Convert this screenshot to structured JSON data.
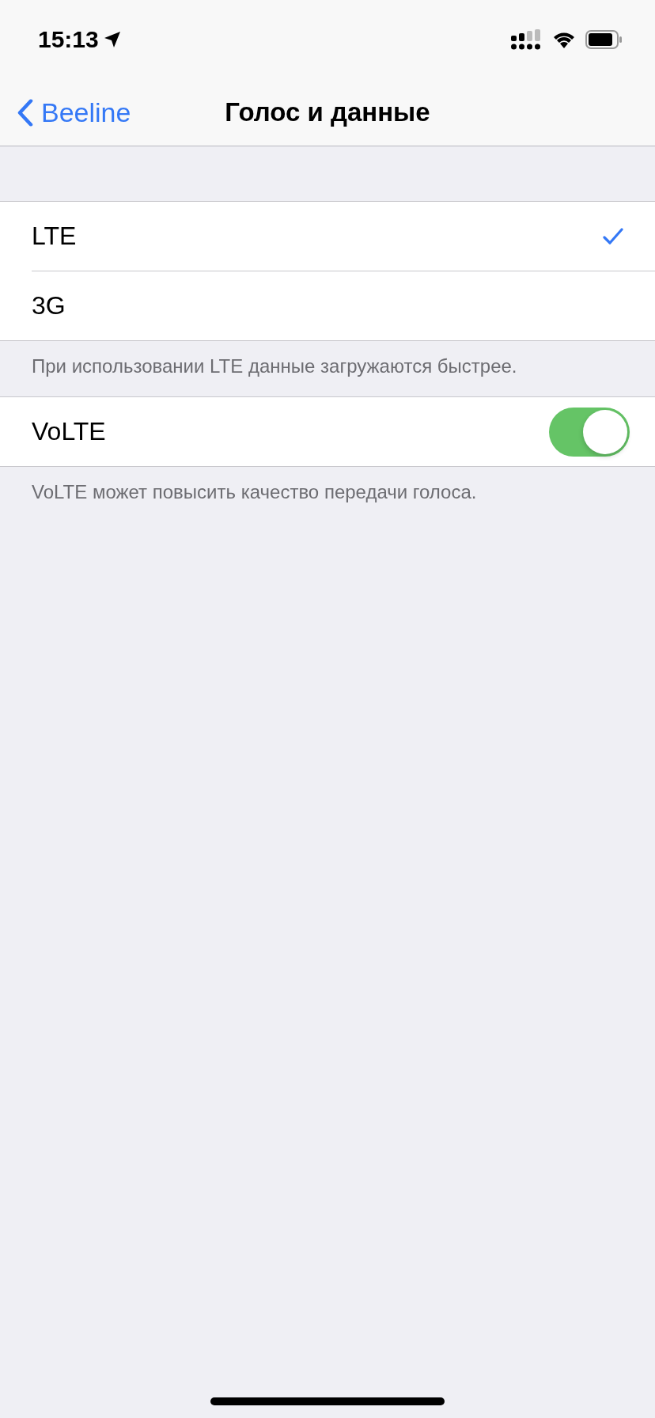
{
  "status_bar": {
    "time": "15:13"
  },
  "nav": {
    "back_label": "Beeline",
    "title": "Голос и данные"
  },
  "network_options": [
    {
      "label": "LTE",
      "selected": true
    },
    {
      "label": "3G",
      "selected": false
    }
  ],
  "network_footer": "При использовании LTE данные загружаются быстрее.",
  "volte": {
    "label": "VoLTE",
    "on": true
  },
  "volte_footer": "VoLTE может повысить качество передачи голоса."
}
